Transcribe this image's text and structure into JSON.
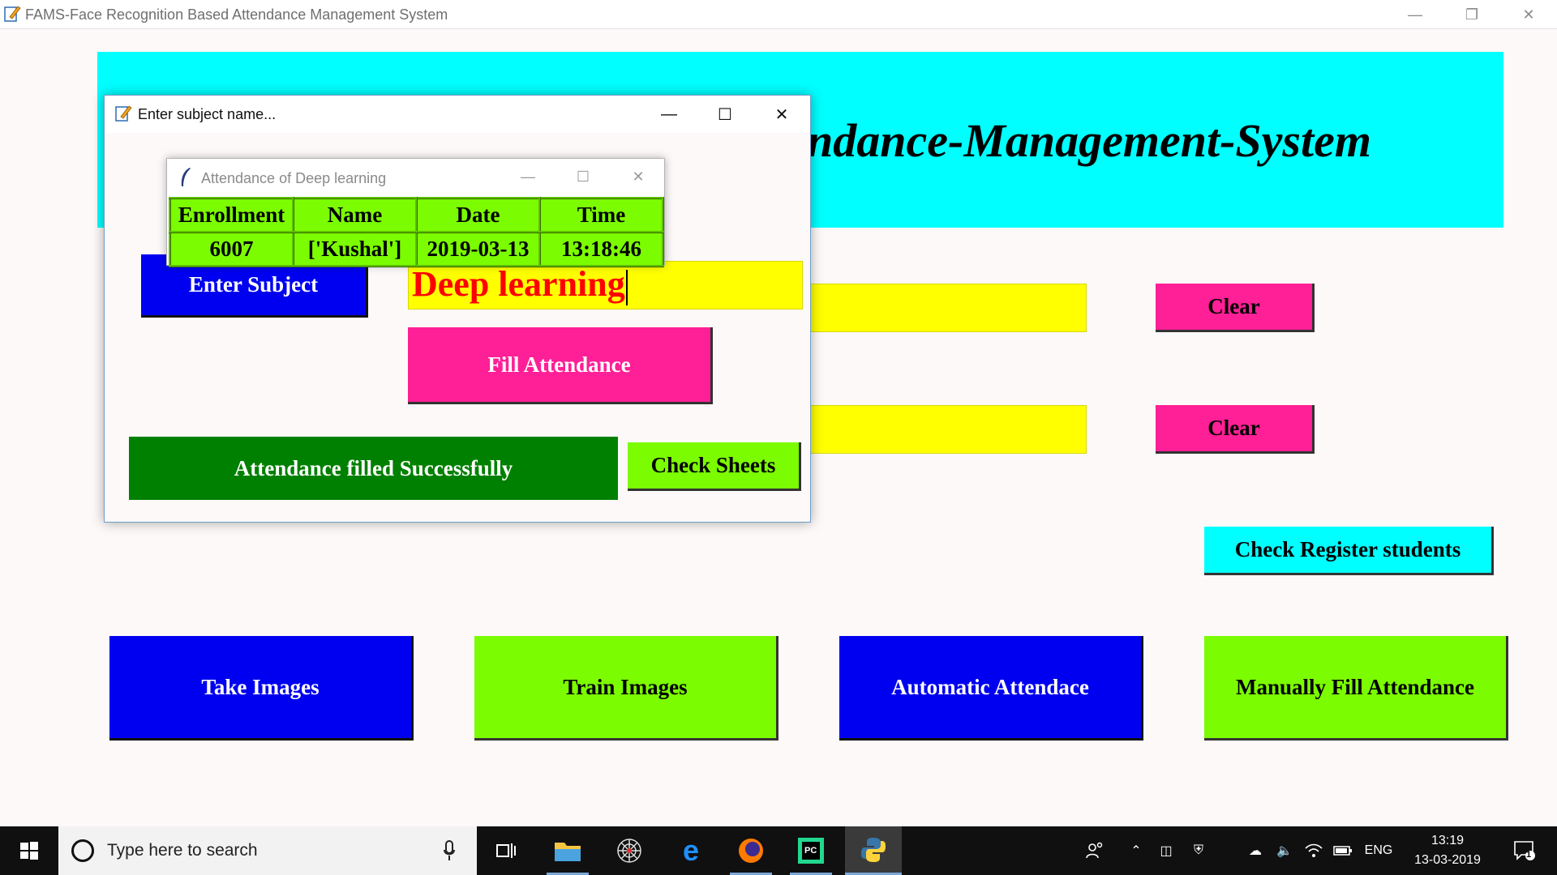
{
  "window": {
    "title": "FAMS-Face Recognition Based Attendance Management System"
  },
  "banner": {
    "title_visible": "ndance-Management-System",
    "color": "#00ffff"
  },
  "main": {
    "clear_button_1": "Clear",
    "clear_button_2": "Clear",
    "check_register_button": "Check Register students",
    "take_images_button": "Take Images",
    "train_images_button": "Train Images",
    "automatic_attendance_button": "Automatic Attendace",
    "manual_attendance_button": "Manually Fill Attendance"
  },
  "dialog": {
    "title": "Enter subject name...",
    "enter_subject_label": "Enter Subject",
    "subject_value": "Deep learning",
    "fill_attendance_button": "Fill Attendance",
    "status_message": "Attendance filled Successfully",
    "check_sheets_button": "Check Sheets"
  },
  "popup": {
    "title": "Attendance of Deep learning",
    "columns": [
      "Enrollment",
      "Name",
      "Date",
      "Time"
    ],
    "rows": [
      [
        "6007",
        "['Kushal']",
        "2019-03-13",
        "13:18:46"
      ]
    ]
  },
  "taskbar": {
    "search_placeholder": "Type here to search",
    "language": "ENG",
    "time": "13:19",
    "date": "13-03-2019",
    "notification_count": "1"
  },
  "colors": {
    "pink": "#ff1f96",
    "blue": "#0000f0",
    "lime": "#7cfc00",
    "yellow": "#ffff00",
    "green": "#008000"
  }
}
